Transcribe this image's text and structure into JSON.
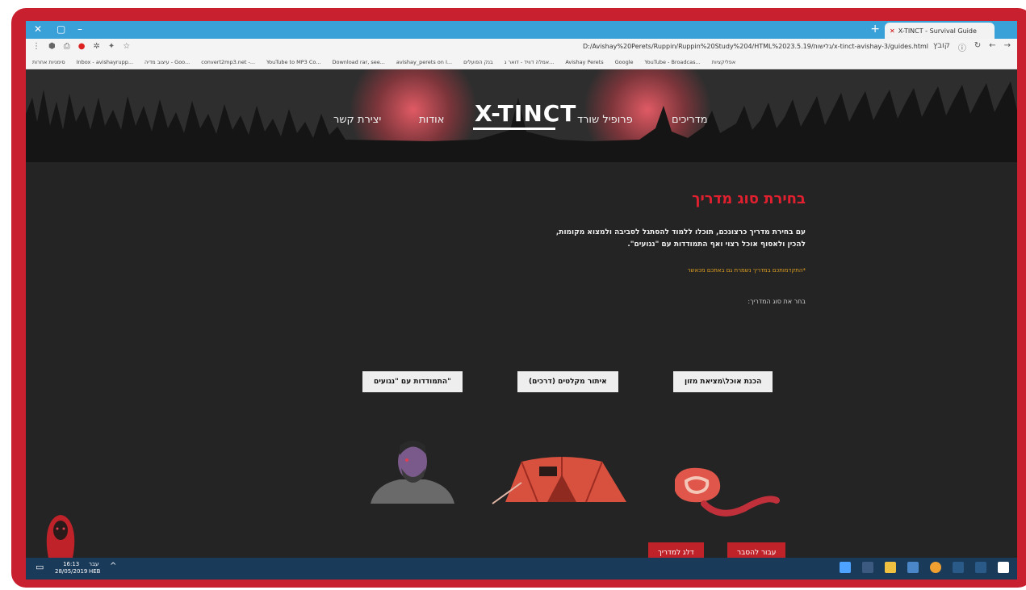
{
  "browser": {
    "tab_title": "X-TINCT - Survival Guide",
    "url": "D:/Avishay%20Perets/Ruppin/Ruppin%20Study%204/HTML%2023.5.19/גלישות/x-tinct-avishay-3/guides.html",
    "url_prefix": "קובץ",
    "bookmarks": [
      "אפליקציות",
      "YouTube - Broadcas...",
      "Google",
      "Avishay Perets",
      "אמלה דוויד - דואר ג...",
      "בנק הפועלים",
      "avishay_perets on I...",
      "Download rar, see...",
      "YouTube to MP3 Co...",
      "convert2mp3.net -...",
      "עיצוב מדיה - Goo...",
      "Inbox - avishayrupp...",
      "סימניות אחרות"
    ]
  },
  "nav": {
    "guides": "מדריכים",
    "survivor_profile": "פרופיל שורד",
    "logo": "X-TINCT",
    "about": "אודות",
    "contact": "יצירת קשר"
  },
  "main": {
    "title": "בחירת סוג מדריך",
    "intro_line1": "עם בחירת מדריך כרצונכם, תוכלו ללמוד להסתגל לסביבה ולמצוא מקומות,",
    "intro_line2": "להכין ולאסוף אוכל רצוי ואף התמודדות עם \"נגועים\".",
    "note": "*התקדמותכם במדריך נשמרת גם באתכם מכאשר",
    "choose_label": "בחר את סוג המדריך:"
  },
  "guides": [
    {
      "label": "הכנת אוכל\\מציאת מזון",
      "icon": "meat-icon"
    },
    {
      "label": "איתור מקלטים (דרכים)",
      "icon": "tent-icon"
    },
    {
      "label": "התמודדות עם \"נגועים\"",
      "icon": "infected-person-icon"
    }
  ],
  "actions": {
    "explain": "עבור להסבר",
    "skip": "דלג למדריך"
  },
  "taskbar": {
    "time": "16:13",
    "date": "28/05/2019",
    "lang_top": "עבר",
    "lang_bottom": "HEB"
  },
  "colors": {
    "accent": "#e0202f",
    "frame": "#c8202f",
    "background": "#242424",
    "note": "#e0a020"
  }
}
